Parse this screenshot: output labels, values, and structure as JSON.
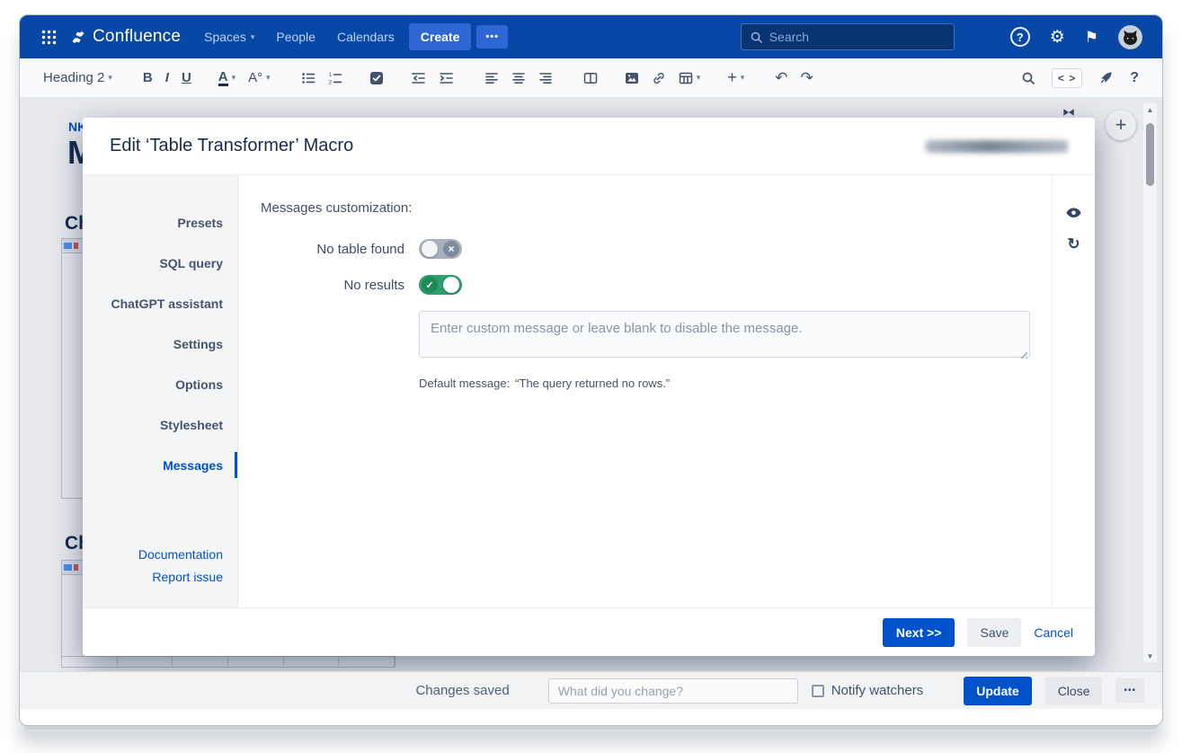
{
  "topnav": {
    "product_name": "Confluence",
    "menu_items": [
      "Spaces",
      "People",
      "Calendars"
    ],
    "create_label": "Create",
    "more_label": "•••",
    "search_placeholder": "Search"
  },
  "toolbar": {
    "paragraph_style": "Heading 2",
    "bold_label": "B",
    "italic_label": "I",
    "underline_label": "U",
    "text_color_label": "A",
    "more_formatting_label": "A°",
    "source_label": "< >",
    "help_label": "?"
  },
  "page": {
    "breadcrumb_fragment": "NK",
    "title_fragment": "M",
    "heading_fragment_1": "Ch",
    "heading_fragment_2": "Ch"
  },
  "modal": {
    "title": "Edit ‘Table Transformer’ Macro",
    "sidebar": {
      "tabs": [
        "Presets",
        "SQL query",
        "ChatGPT assistant",
        "Settings",
        "Options",
        "Stylesheet",
        "Messages"
      ],
      "selected_tab": "Messages",
      "links": [
        "Documentation",
        "Report issue"
      ]
    },
    "content": {
      "heading": "Messages customization:",
      "rows": [
        {
          "label": "No table found",
          "state": "off"
        },
        {
          "label": "No results",
          "state": "on"
        }
      ],
      "message_placeholder": "Enter custom message or leave blank to disable the message.",
      "default_message_label": "Default message:",
      "default_message_value": "“The query returned no rows.”"
    },
    "footer": {
      "next_label": "Next >>",
      "save_label": "Save",
      "cancel_label": "Cancel"
    }
  },
  "bottombar": {
    "status_text": "Changes saved",
    "comment_placeholder": "What did you change?",
    "notify_watchers_label": "Notify watchers",
    "update_label": "Update",
    "close_label": "Close",
    "more_label": "•••"
  },
  "icons": {
    "chevron_down": "▾",
    "undo": "↶",
    "redo": "↷",
    "gear": "⚙",
    "flag": "⚑",
    "question": "?",
    "plus": "+",
    "check": "✓",
    "cross": "×",
    "refresh": "↻",
    "scroll_up": "▲",
    "scroll_down": "▼"
  },
  "colors": {
    "nav_blue": "#0747A6",
    "accent_blue": "#0052CC",
    "toggle_on_green": "#2E9E6B",
    "toggle_off_gray": "#A9B0BD",
    "text_primary": "#172B4D",
    "text_secondary": "#42526E"
  }
}
